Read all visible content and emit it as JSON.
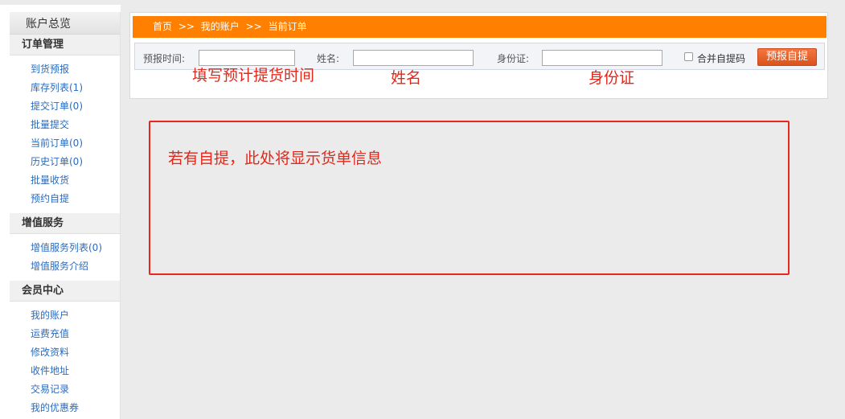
{
  "sidebar": {
    "title": "账户总览",
    "sections": [
      {
        "title": "订单管理",
        "items": [
          "到货预报",
          "库存列表(1)",
          "提交订单(0)",
          "批量提交",
          "当前订单(0)",
          "历史订单(0)",
          "批量收货",
          "预约自提"
        ]
      },
      {
        "title": "增值服务",
        "items": [
          "增值服务列表(0)",
          "增值服务介绍"
        ]
      },
      {
        "title": "会员中心",
        "items": [
          "我的账户",
          "运费充值",
          "修改资料",
          "收件地址",
          "交易记录",
          "我的优惠券"
        ]
      }
    ]
  },
  "breadcrumb": {
    "home": "首页",
    "separator": ">>",
    "account": "我的账户",
    "current": "当前订单"
  },
  "form": {
    "time_label": "预报时间:",
    "time_value": "",
    "name_label": "姓名:",
    "name_value": "",
    "id_label": "身份证:",
    "id_value": "",
    "merge_label": "合并自提码",
    "merge_checked": false,
    "submit_label": "预报自提"
  },
  "annotations": {
    "time_hint": "填写预计提货时间",
    "name_hint": "姓名",
    "id_hint": "身份证",
    "info_text": "若有自提，此处将显示货单信息"
  },
  "colors": {
    "accent_orange": "#ff8000",
    "button": "#e0612a",
    "annotation_red": "#e0281b",
    "link_blue": "#2a6bbf"
  }
}
